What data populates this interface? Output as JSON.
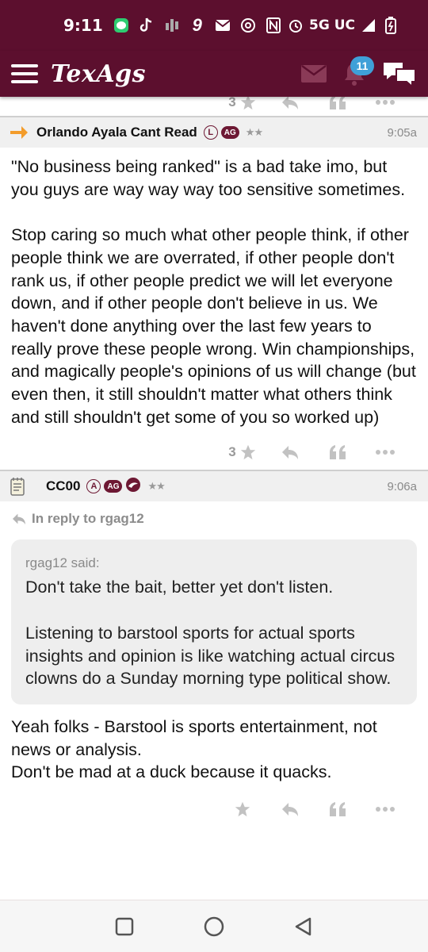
{
  "status_bar": {
    "time": "9:11",
    "left_icons": [
      "messages-app-icon",
      "tiktok-icon",
      "signal-app-icon",
      "nine-app-icon",
      "mail-notification-icon",
      "chrome-icon"
    ],
    "nine_glyph": "9",
    "network": "5G UC",
    "right_icons": [
      "nfc-icon",
      "alarm-icon",
      "signal-strength-icon",
      "battery-charging-icon"
    ]
  },
  "header": {
    "logo": "TexAgs",
    "notification_count": "11",
    "colors": {
      "brand": "#5c0f2e",
      "badge": "#3fa0d8"
    }
  },
  "top_action_row": {
    "star_count": "3"
  },
  "posts": [
    {
      "author": "Orlando Ayala Cant Read",
      "badges": [
        "L",
        "AG"
      ],
      "stars": "★★",
      "time": "9:05a",
      "lead_icon": "orange-arrow-icon",
      "paragraphs": [
        "\"No business being ranked\" is a bad take imo, but you guys are way way way too sensitive sometimes.",
        "Stop caring so much what other people think, if other people think we are overrated, if other people don't rank us, if other people predict we will let everyone down, and if other people don't believe in us. We haven't done anything over the last few years to really prove these people wrong. Win championships, and magically people's opinions of us will change (but even then, it still shouldn't matter what others think and still shouldn't get some of you so worked up)"
      ],
      "star_count": "3"
    },
    {
      "author": "CC00",
      "badges": [
        "A",
        "AG"
      ],
      "stars": "★★",
      "time": "9:06a",
      "lead_icon": "notepad-icon",
      "reply_to": "In reply to rgag12",
      "quote": {
        "author": "rgag12 said:",
        "paragraphs": [
          "Don't take the bait, better yet don't listen.",
          "Listening to barstool sports for actual sports insights and opinion is like watching actual circus clowns do a Sunday morning type political show."
        ]
      },
      "lines": [
        "Yeah folks - Barstool is sports entertainment, not news or analysis.",
        "Don't be mad at a duck because it quacks."
      ],
      "star_count": ""
    }
  ]
}
